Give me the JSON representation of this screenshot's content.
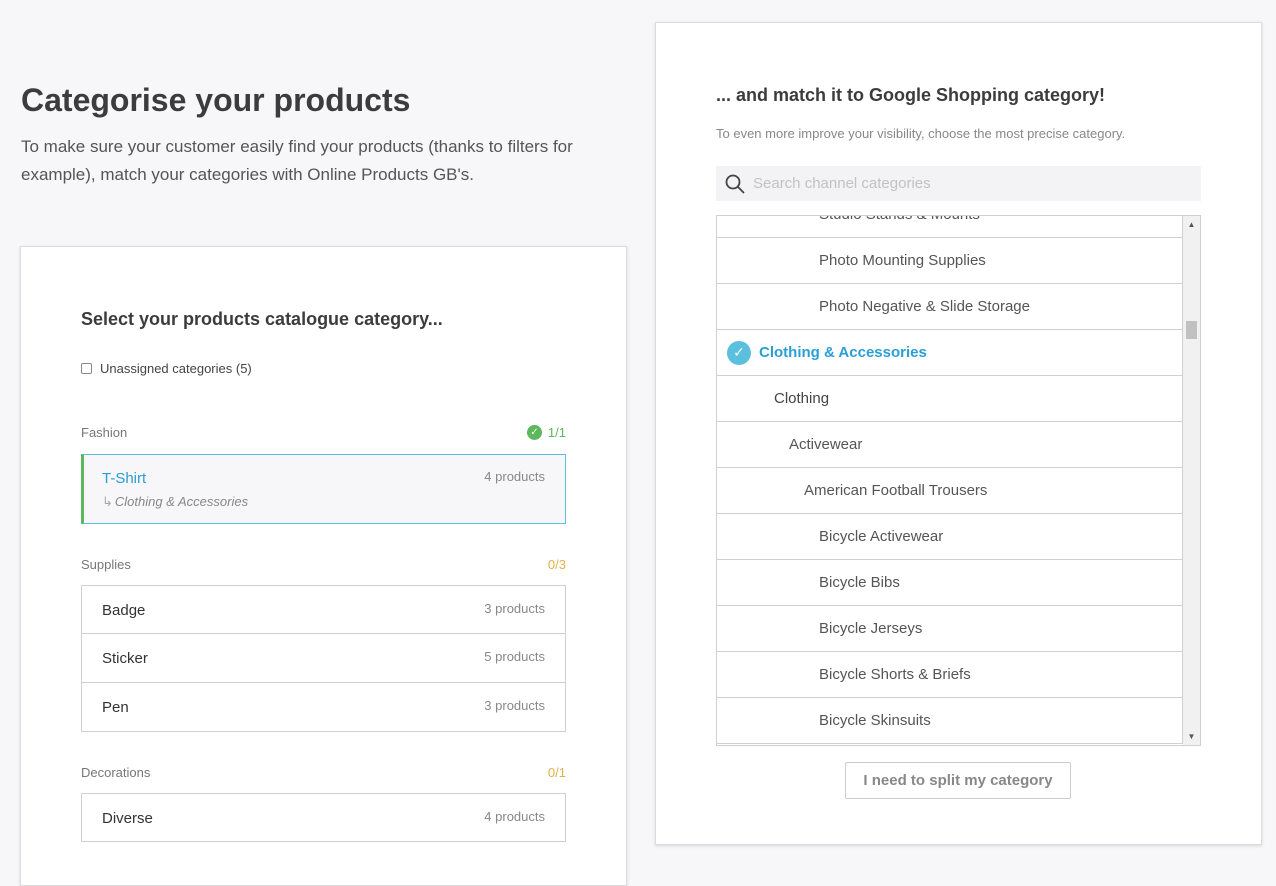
{
  "header": {
    "title": "Categorise your products",
    "description": "To make sure your customer easily find your products (thanks to filters for example), match your categories with Online Products GB's."
  },
  "left_panel": {
    "heading": "Select your products catalogue category...",
    "unassigned_label": "Unassigned categories (5)",
    "groups": [
      {
        "name": "Fashion",
        "count": "1/1",
        "status": "complete",
        "items": [
          {
            "name": "T-Shirt",
            "products": "4 products",
            "matched": "Clothing & Accessories",
            "selected": true
          }
        ]
      },
      {
        "name": "Supplies",
        "count": "0/3",
        "status": "pending",
        "items": [
          {
            "name": "Badge",
            "products": "3 products"
          },
          {
            "name": "Sticker",
            "products": "5 products"
          },
          {
            "name": "Pen",
            "products": "3 products"
          }
        ]
      },
      {
        "name": "Decorations",
        "count": "0/1",
        "status": "pending",
        "items": [
          {
            "name": "Diverse",
            "products": "4 products"
          }
        ]
      }
    ]
  },
  "right_panel": {
    "heading": "... and match it to Google Shopping category!",
    "description": "To even more improve your visibility, choose the most precise category.",
    "search": {
      "placeholder": "Search channel categories",
      "value": ""
    },
    "tree": [
      {
        "label": "Studio Stands & Mounts",
        "level": 5
      },
      {
        "label": "Photo Mounting Supplies",
        "level": 5
      },
      {
        "label": "Photo Negative & Slide Storage",
        "level": 5
      },
      {
        "label": "Clothing & Accessories",
        "level": 1,
        "selected": true
      },
      {
        "label": "Clothing",
        "level": 2
      },
      {
        "label": "Activewear",
        "level": 3
      },
      {
        "label": "American Football Trousers",
        "level": 4
      },
      {
        "label": "Bicycle Activewear",
        "level": 5
      },
      {
        "label": "Bicycle Bibs",
        "level": 5
      },
      {
        "label": "Bicycle Jerseys",
        "level": 5
      },
      {
        "label": "Bicycle Shorts & Briefs",
        "level": 5
      },
      {
        "label": "Bicycle Skinsuits",
        "level": 5
      }
    ],
    "split_button": "I need to split my category"
  },
  "colors": {
    "accent": "#2a9fd6",
    "success": "#5cb85c",
    "pending": "#e2b04a",
    "selected_border": "#5bc0de"
  },
  "icons": {
    "complete": "check-circle-icon",
    "selected": "check-circle-icon",
    "search": "search-icon",
    "sub_arrow": "corner-arrow-icon"
  }
}
